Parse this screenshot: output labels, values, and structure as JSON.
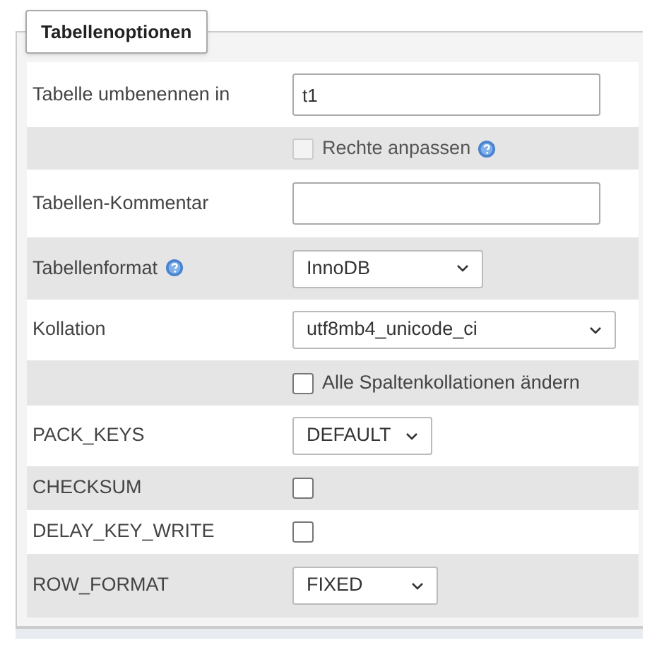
{
  "legend": "Tabellenoptionen",
  "rows": [
    {
      "kind": "text",
      "label": "Tabelle umbenennen in",
      "label_help": false,
      "value": "t1"
    },
    {
      "kind": "checkbox",
      "label_help": false,
      "text": "Rechte anpassen",
      "text_help": true,
      "checked": false,
      "disabled": true
    },
    {
      "kind": "text",
      "label": "Tabellen-Kommentar",
      "label_help": false
    },
    {
      "kind": "select",
      "label": "Tabellenformat",
      "label_help": true,
      "value": "InnoDB"
    },
    {
      "kind": "select",
      "label": "Kollation",
      "label_help": false,
      "value": "utf8mb4_unicode_ci"
    },
    {
      "kind": "checkbox",
      "label_help": false,
      "text": "Alle Spaltenkollationen ändern",
      "text_help": false,
      "checked": false,
      "disabled": false
    },
    {
      "kind": "select",
      "label": "PACK_KEYS",
      "label_help": false,
      "value": "DEFAULT"
    },
    {
      "kind": "checkbox",
      "label": "CHECKSUM",
      "label_help": false,
      "checked": false,
      "disabled": false
    },
    {
      "kind": "checkbox",
      "label": "DELAY_KEY_WRITE",
      "label_help": false,
      "checked": false,
      "disabled": false
    },
    {
      "kind": "select",
      "label": "ROW_FORMAT",
      "label_help": false,
      "value": "FIXED"
    }
  ]
}
